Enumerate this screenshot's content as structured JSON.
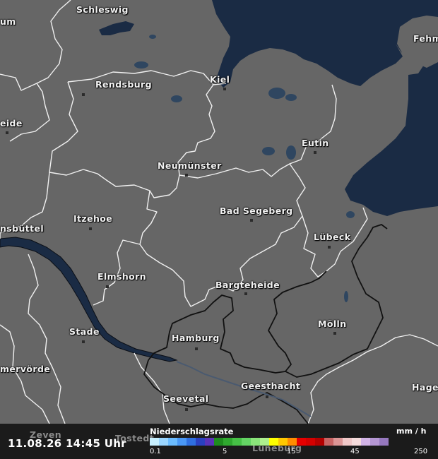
{
  "map": {
    "land_color": "#666666",
    "sea_color": "#1a2b44",
    "cities": [
      {
        "key": "schleswig",
        "name": "Schleswig"
      },
      {
        "key": "husum",
        "name": "um"
      },
      {
        "key": "fehmarn",
        "name": "Fehm"
      },
      {
        "key": "kiel",
        "name": "Kiel"
      },
      {
        "key": "rendsburg",
        "name": "Rendsburg"
      },
      {
        "key": "heide",
        "name": "eide"
      },
      {
        "key": "eutin",
        "name": "Eutin"
      },
      {
        "key": "neumuenster",
        "name": "Neumünster"
      },
      {
        "key": "bad-segeberg",
        "name": "Bad Segeberg"
      },
      {
        "key": "itzehoe",
        "name": "Itzehoe"
      },
      {
        "key": "brunsbuettel",
        "name": "nsbüttel"
      },
      {
        "key": "luebeck",
        "name": "Lübeck"
      },
      {
        "key": "elmshorn",
        "name": "Elmshorn"
      },
      {
        "key": "bargteheide",
        "name": "Bargteheide"
      },
      {
        "key": "moelln",
        "name": "Mölln"
      },
      {
        "key": "stade",
        "name": "Stade"
      },
      {
        "key": "hamburg",
        "name": "Hamburg"
      },
      {
        "key": "bremervoerde",
        "name": "mervörde"
      },
      {
        "key": "geesthacht",
        "name": "Geesthacht"
      },
      {
        "key": "hagen",
        "name": "Hagen"
      },
      {
        "key": "seevetal",
        "name": "Seevetal"
      },
      {
        "key": "zeven",
        "name": "Zeven"
      },
      {
        "key": "tostedt",
        "name": "Tostedt"
      },
      {
        "key": "lueneburg",
        "name": "Lüneburg"
      }
    ]
  },
  "footer": {
    "datetime": "11.08.26 14:45 Uhr",
    "legend_title": "Niederschlagsrate",
    "unit": "mm / h",
    "ticks": [
      "0.1",
      "5",
      "15",
      "45",
      "250"
    ],
    "scale_colors": [
      "#c8f0ff",
      "#9bd6ff",
      "#6cbcff",
      "#4a98f5",
      "#2f6fe0",
      "#2a40c0",
      "#5a32b8",
      "#1e8c1e",
      "#2fa82f",
      "#46c046",
      "#64d464",
      "#8ae47a",
      "#aef08e",
      "#ffff00",
      "#ffc800",
      "#ff8c00",
      "#e60000",
      "#d40000",
      "#b40000",
      "#c86464",
      "#dc9696",
      "#f0c8c8",
      "#f5dcdc",
      "#d2b4e6",
      "#b496d2",
      "#9678be"
    ]
  }
}
